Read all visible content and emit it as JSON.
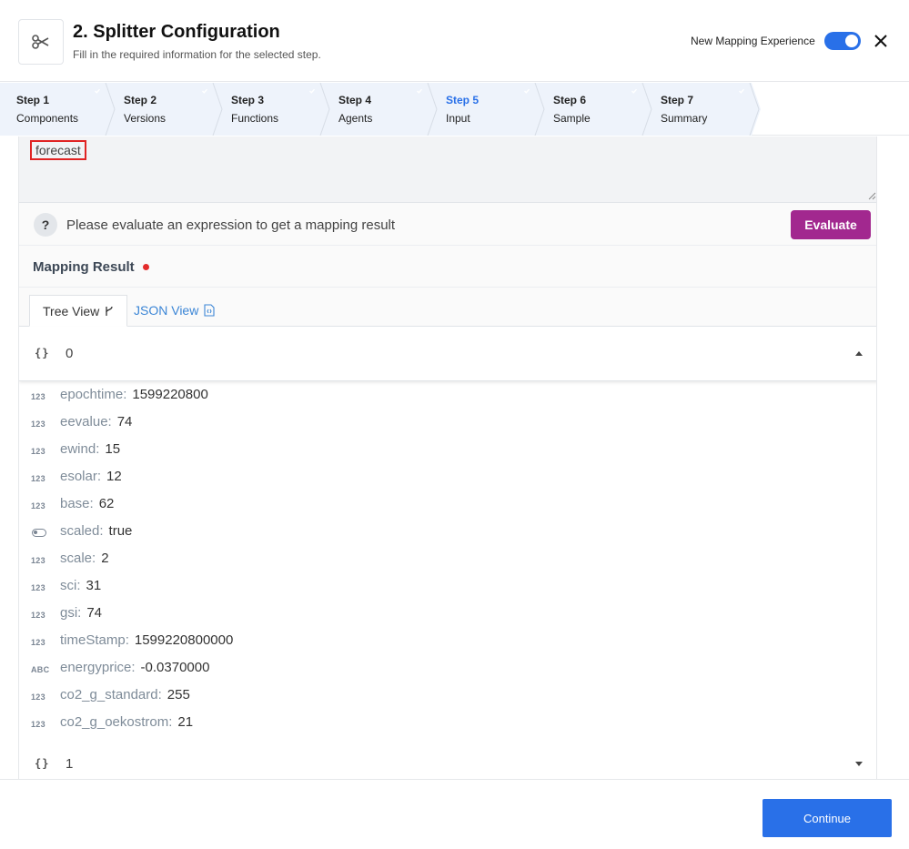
{
  "header": {
    "title": "2. Splitter Configuration",
    "subtitle": "Fill in the required information for the selected step.",
    "tool_icon": "scissors-icon",
    "new_mapping_label": "New Mapping Experience",
    "new_mapping_enabled": true,
    "close_icon": "close-icon"
  },
  "steps": [
    {
      "num": "Step 1",
      "label": "Components",
      "completed": true
    },
    {
      "num": "Step 2",
      "label": "Versions",
      "completed": true
    },
    {
      "num": "Step 3",
      "label": "Functions",
      "completed": true
    },
    {
      "num": "Step 4",
      "label": "Agents",
      "completed": true
    },
    {
      "num": "Step 5",
      "label": "Input",
      "completed": true,
      "active": true
    },
    {
      "num": "Step 6",
      "label": "Sample",
      "completed": true
    },
    {
      "num": "Step 7",
      "label": "Summary",
      "completed": true
    }
  ],
  "expression": {
    "value": "forecast"
  },
  "evaluate": {
    "message": "Please evaluate an expression to get a mapping result",
    "button_label": "Evaluate",
    "button_color": "#a2288f"
  },
  "mapping_result": {
    "title": "Mapping Result",
    "status_color": "#e32b2b"
  },
  "tabs": [
    {
      "label": "Tree View",
      "icon": "tree-branch-icon",
      "active": true
    },
    {
      "label": "JSON View",
      "icon": "json-file-icon",
      "active": false
    }
  ],
  "groups": [
    {
      "index": "0",
      "expanded": true
    },
    {
      "index": "1",
      "expanded": false
    }
  ],
  "tree_items": [
    {
      "type": "123",
      "key": "epochtime:",
      "value": "1599220800"
    },
    {
      "type": "123",
      "key": "eevalue:",
      "value": "74"
    },
    {
      "type": "123",
      "key": "ewind:",
      "value": "15"
    },
    {
      "type": "123",
      "key": "esolar:",
      "value": "12"
    },
    {
      "type": "123",
      "key": "base:",
      "value": "62"
    },
    {
      "type": "bool",
      "key": "scaled:",
      "value": "true"
    },
    {
      "type": "123",
      "key": "scale:",
      "value": "2"
    },
    {
      "type": "123",
      "key": "sci:",
      "value": "31"
    },
    {
      "type": "123",
      "key": "gsi:",
      "value": "74"
    },
    {
      "type": "123",
      "key": "timeStamp:",
      "value": "1599220800000"
    },
    {
      "type": "ABC",
      "key": "energyprice:",
      "value": "-0.0370000"
    },
    {
      "type": "123",
      "key": "co2_g_standard:",
      "value": "255"
    },
    {
      "type": "123",
      "key": "co2_g_oekostrom:",
      "value": "21"
    }
  ],
  "footer": {
    "continue_label": "Continue",
    "accent": "#2970e8"
  }
}
